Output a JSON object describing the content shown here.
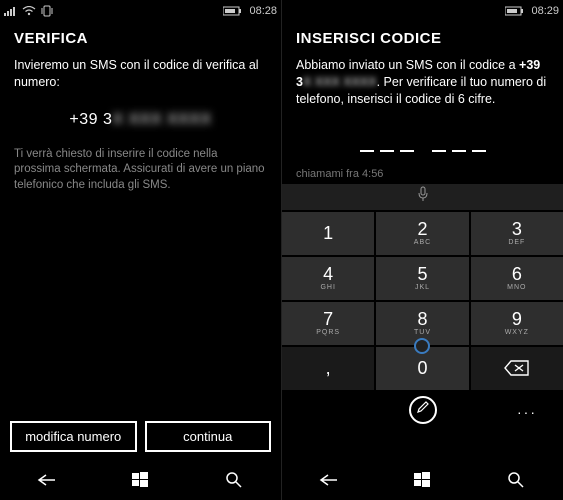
{
  "left": {
    "status": {
      "time": "08:28"
    },
    "title": "VERIFICA",
    "intro": "Invieremo un SMS con il codice di verifica al numero:",
    "phonePrefix": "+39 3",
    "phoneHidden": "X XXX XXXX",
    "hint": "Ti verrà chiesto di inserire il codice nella prossima schermata. Assicurati di avere un piano telefonico che includa gli SMS.",
    "buttons": {
      "modify": "modifica numero",
      "continue": "continua"
    }
  },
  "right": {
    "status": {
      "time": "08:29"
    },
    "title": "INSERISCI CODICE",
    "body1": "Abbiamo inviato un SMS con il codice a ",
    "bodyBold": "+39 3",
    "bodyHidden": "X XXX XXXX",
    "body2": ". Per verificare il tuo numero di telefono, inserisci il codice di 6 cifre.",
    "callMe": "chiamami fra 4:56",
    "keys": [
      {
        "d": "1",
        "l": ""
      },
      {
        "d": "2",
        "l": "ABC"
      },
      {
        "d": "3",
        "l": "DEF"
      },
      {
        "d": "4",
        "l": "GHI"
      },
      {
        "d": "5",
        "l": "JKL"
      },
      {
        "d": "6",
        "l": "MNO"
      },
      {
        "d": "7",
        "l": "PQRS"
      },
      {
        "d": "8",
        "l": "TUV"
      },
      {
        "d": "9",
        "l": "WXYZ"
      },
      {
        "d": ",",
        "l": ""
      },
      {
        "d": "0",
        "l": ""
      }
    ]
  }
}
